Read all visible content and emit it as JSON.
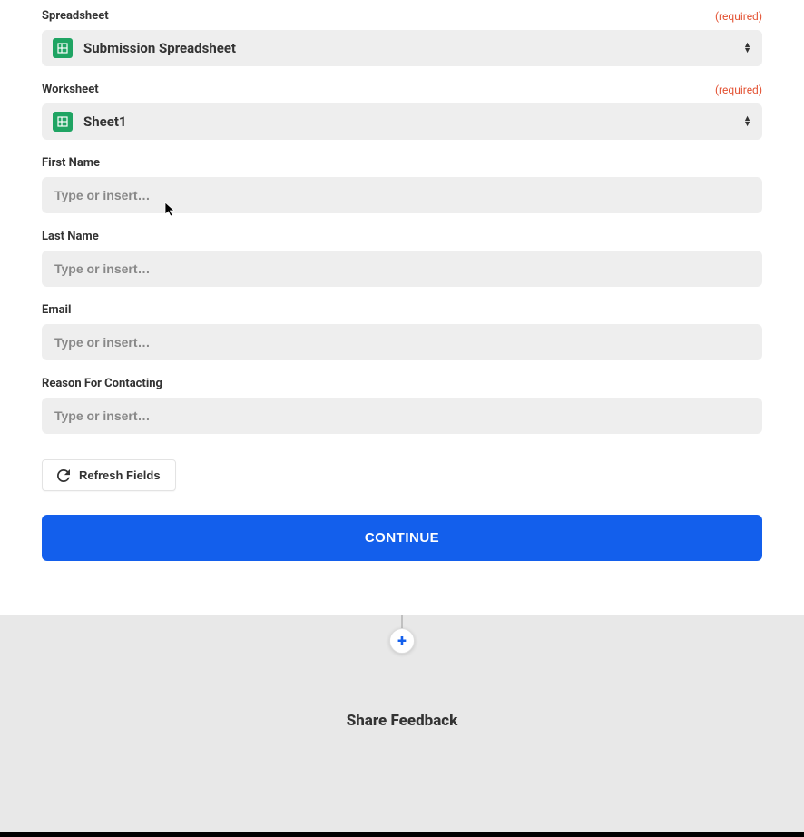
{
  "fields": {
    "spreadsheet": {
      "label": "Spreadsheet",
      "required_text": "(required)",
      "value": "Submission Spreadsheet"
    },
    "worksheet": {
      "label": "Worksheet",
      "required_text": "(required)",
      "value": "Sheet1"
    },
    "first_name": {
      "label": "First Name",
      "placeholder": "Type or insert…"
    },
    "last_name": {
      "label": "Last Name",
      "placeholder": "Type or insert…"
    },
    "email": {
      "label": "Email",
      "placeholder": "Type or insert…"
    },
    "reason": {
      "label": "Reason For Contacting",
      "placeholder": "Type or insert…"
    }
  },
  "buttons": {
    "refresh": "Refresh Fields",
    "continue": "CONTINUE",
    "add_step": "+"
  },
  "footer": {
    "share_feedback": "Share Feedback"
  }
}
